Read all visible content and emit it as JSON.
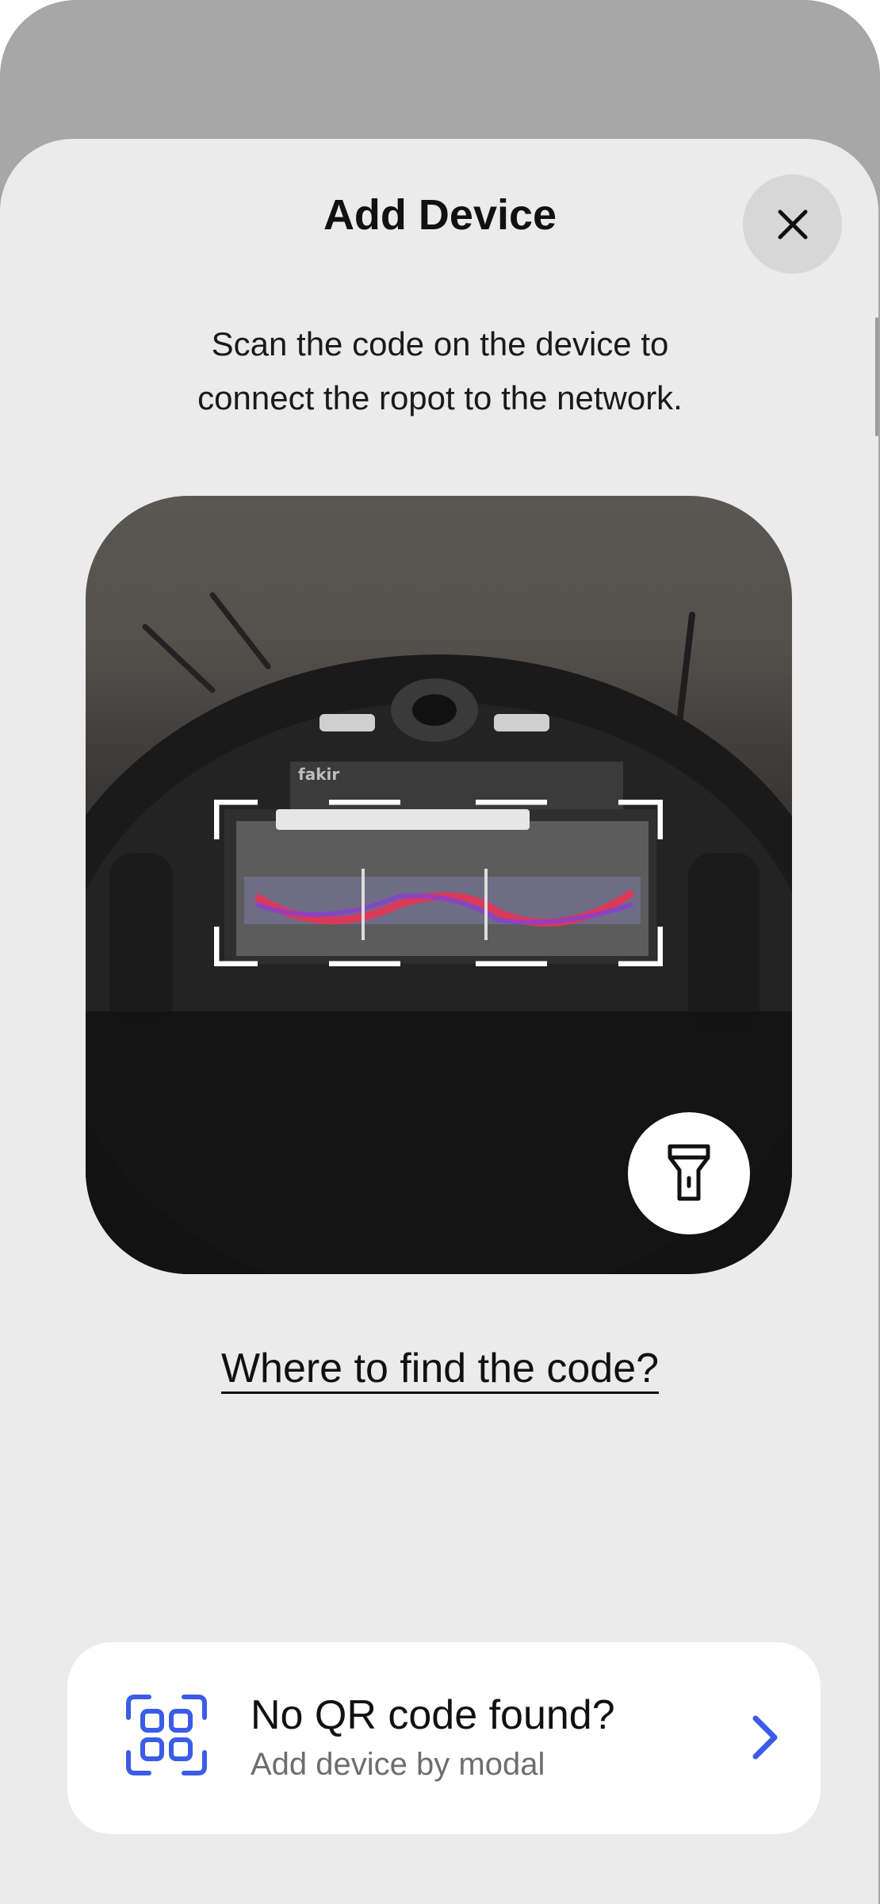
{
  "header": {
    "title": "Add Device",
    "close_icon": "close-icon"
  },
  "instructions": {
    "line1": "Scan the code on the device to",
    "line2": "connect the ropot to the network."
  },
  "scanner": {
    "flashlight_icon": "flashlight-icon",
    "device_label_brand": "fakir"
  },
  "help": {
    "link_text": "Where to find the code?"
  },
  "manual_entry": {
    "title": "No QR code found?",
    "subtitle": "Add device by modal",
    "icon": "qr-scan-icon",
    "chevron_icon": "chevron-right-icon"
  },
  "colors": {
    "accent": "#3b5ce6",
    "sheet": "#ebebeb",
    "frame": "#a7a7a7"
  }
}
